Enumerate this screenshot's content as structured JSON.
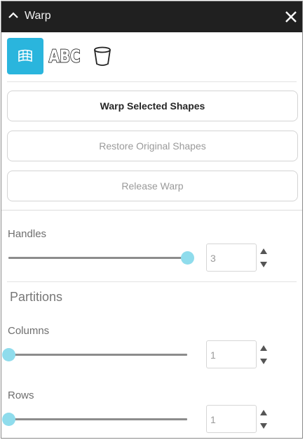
{
  "window": {
    "title": "Warp"
  },
  "toolbar": {
    "modes": [
      {
        "icon": "warp-grid-icon",
        "active": true
      },
      {
        "icon": "text-abc-icon",
        "active": false
      },
      {
        "icon": "envelope-cup-icon",
        "active": false
      }
    ]
  },
  "actions": {
    "warp_label": "Warp Selected Shapes",
    "restore_label": "Restore Original Shapes",
    "release_label": "Release Warp"
  },
  "handles": {
    "label": "Handles",
    "value": "3",
    "slider_fraction": 1.0
  },
  "partitions": {
    "title": "Partitions",
    "columns": {
      "label": "Columns",
      "value": "1",
      "slider_fraction": 0.0
    },
    "rows": {
      "label": "Rows",
      "value": "1",
      "slider_fraction": 0.0
    }
  },
  "colors": {
    "accent": "#2ab5dd",
    "thumb": "#8fdcec",
    "titlebar": "#202020"
  }
}
